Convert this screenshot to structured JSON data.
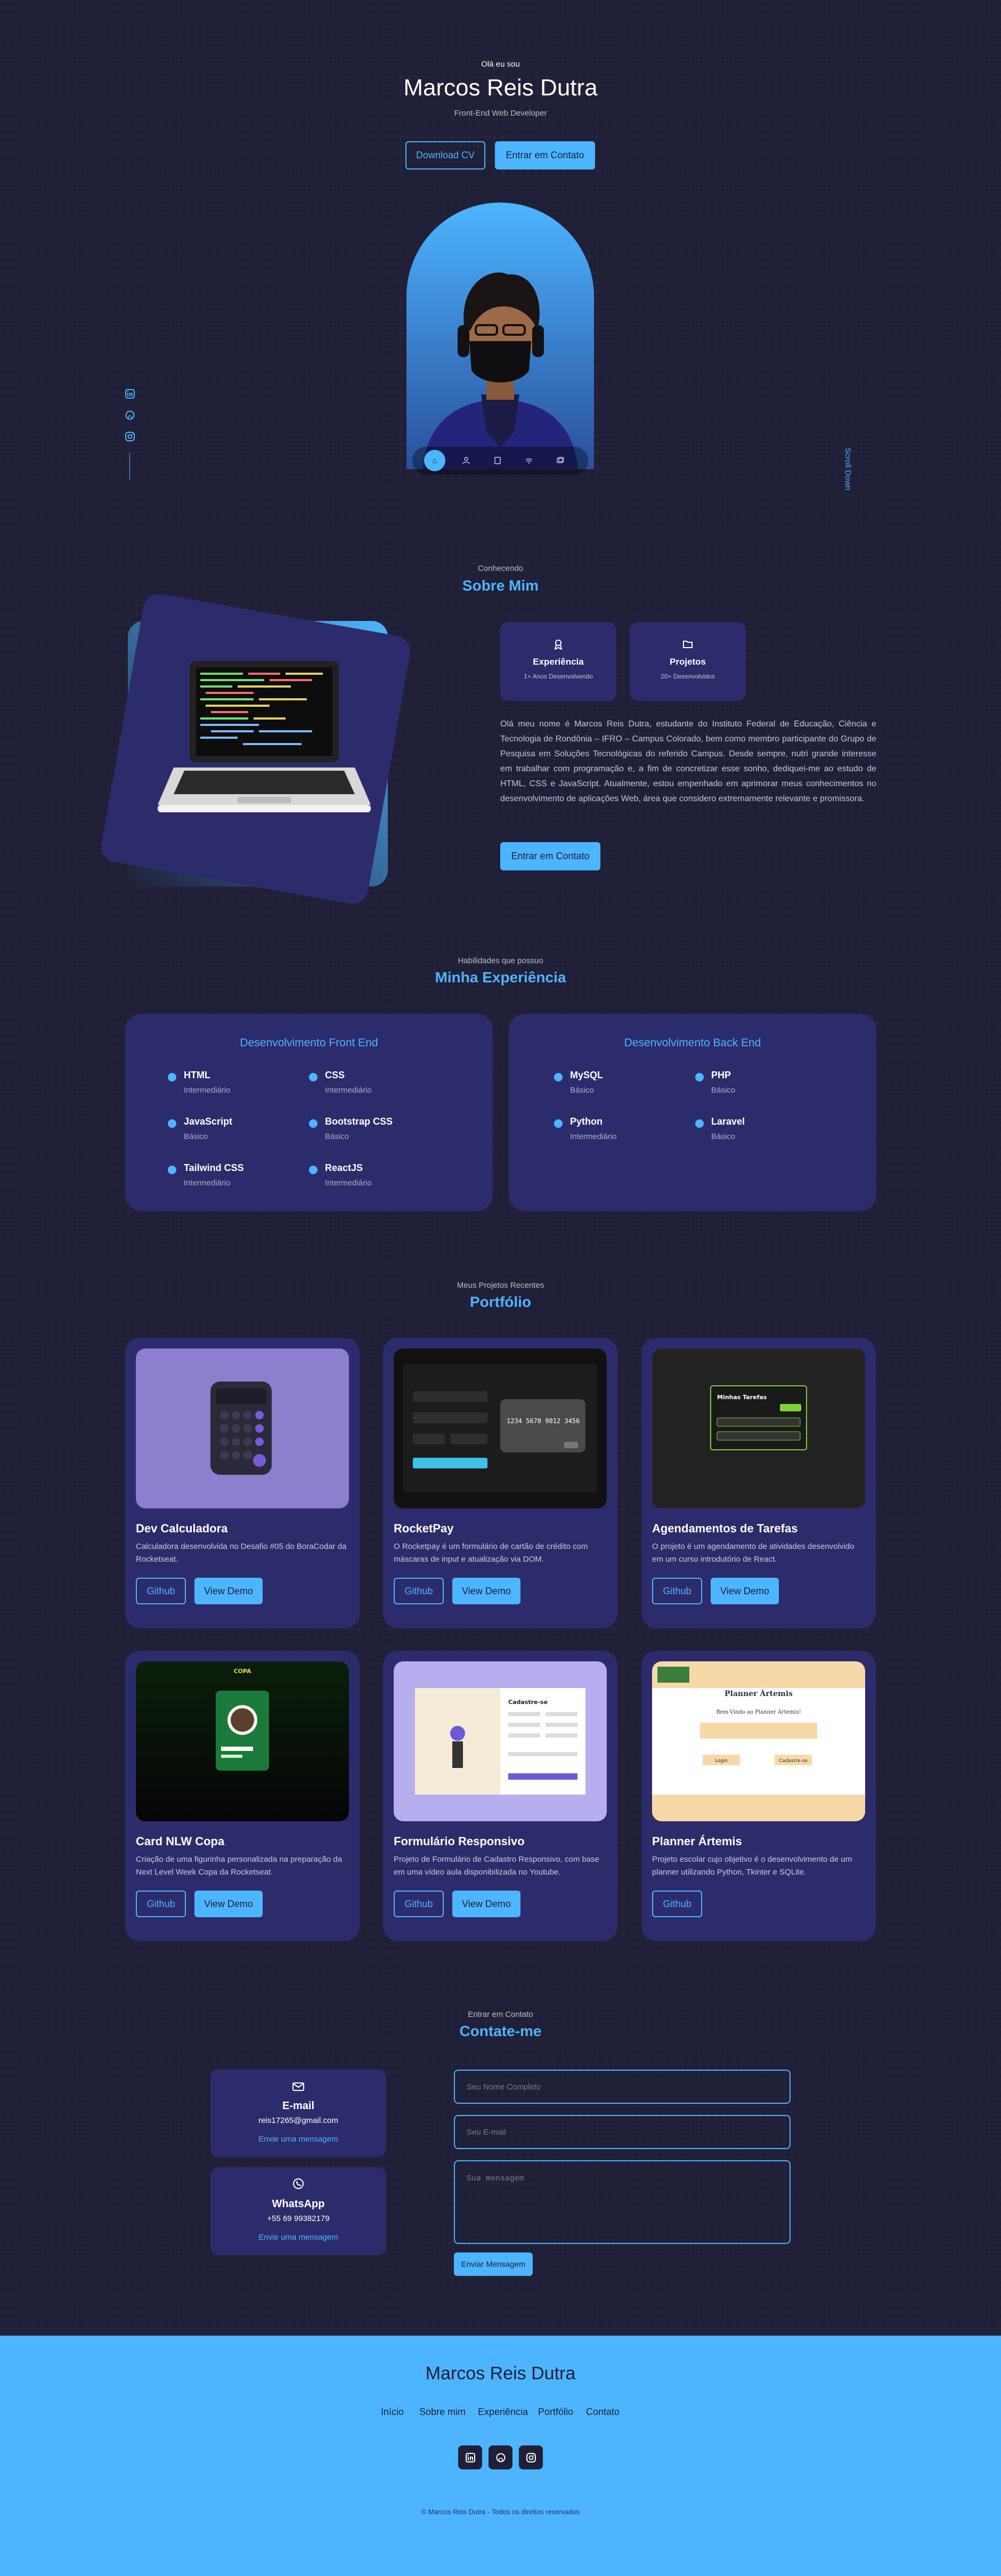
{
  "header": {
    "greeting": "Olá eu sou",
    "name": "Marcos Reis Dutra",
    "role": "Front-End Web Developer",
    "download_cv": "Download CV",
    "contact_btn": "Entrar em Contato",
    "scroll_down": "Scroll Down"
  },
  "about": {
    "small": "Conhecendo",
    "title": "Sobre Mim",
    "card1_title": "Experiência",
    "card1_sub": "1+ Anos Desenvolvendo",
    "card2_title": "Projetos",
    "card2_sub": "20+ Desenvolvidos",
    "paragraph": "Olá meu nome é Marcos Reis Dutra, estudante do Instituto Federal de Educação, Ciência e Tecnologia de Rondônia – IFRO – Campus Colorado, bem como membro participante do Grupo de Pesquisa em Soluções Tecnológicas do referido Campus. Desde sempre, nutri grande interesse em trabalhar com programação e, a fim de concretizar esse sonho, dediquei-me ao estudo de HTML, CSS e JavaScript. Atualmente, estou empenhado em aprimorar meus conhecimentos no desenvolvimento de aplicações Web, área que considero extremamente relevante e promissora.",
    "button": "Entrar em Contato"
  },
  "experience": {
    "small": "Habilidades que possuo",
    "title": "Minha Experiência",
    "frontend_title": "Desenvolvimento Front End",
    "frontend": [
      {
        "name": "HTML",
        "level": "Intermediário"
      },
      {
        "name": "CSS",
        "level": "Intermediário"
      },
      {
        "name": "JavaScript",
        "level": "Básico"
      },
      {
        "name": "Bootstrap CSS",
        "level": "Básico"
      },
      {
        "name": "Tailwind CSS",
        "level": "Intermediário"
      },
      {
        "name": "ReactJS",
        "level": "Intermediário"
      }
    ],
    "backend_title": "Desenvolvimento Back End",
    "backend": [
      {
        "name": "MySQL",
        "level": "Básico"
      },
      {
        "name": "PHP",
        "level": "Básico"
      },
      {
        "name": "Python",
        "level": "Intermediário"
      },
      {
        "name": "Laravel",
        "level": "Básico"
      }
    ]
  },
  "portfolio": {
    "small": "Meus Projetos Recentes",
    "title": "Portfólio",
    "github": "Github",
    "demo": "View Demo",
    "projects": [
      {
        "title": "Dev Calculadora",
        "desc": "Calculadora desenvolvida no Desafio #05 do BoraCodar da Rocketseat."
      },
      {
        "title": "RocketPay",
        "desc": "O Rocketpay é um formulário de cartão de crédito com máscaras de input e atualização via DOM."
      },
      {
        "title": "Agendamentos de Tarefas",
        "desc": "O projeto é um agendamento de atividades desenvolvido em um curso introdutório de React."
      },
      {
        "title": "Card NLW Copa",
        "desc": "Criação de uma figurinha personalizada na preparação da Next Level Week Copa da Rocketseat."
      },
      {
        "title": "Formulário Responsivo",
        "desc": "Projeto de Formulário de Cadastro Responsivo, com base em uma vídeo aula disponibilizada no Youtube."
      },
      {
        "title": "Planner Ártemis",
        "desc": "Projeto escolar cujo objetivo é o desenvolvimento de um planner utilizando Python, Tkinter e SQLite."
      }
    ],
    "mock": {
      "card_number": "1234 5678 9012 3456",
      "todo_title": "Minhas Tarefas",
      "copa": "COPA",
      "form_title": "Cadastre-se",
      "planner_title": "Planner Ártemis",
      "planner_welcome": "Bem-Vindo ao Planner Ártemis!",
      "planner_login": "Login",
      "planner_cad": "Cadastre-se"
    }
  },
  "contact": {
    "small": "Entrar em Contato",
    "title": "Contate-me",
    "email_title": "E-mail",
    "email_value": "reis17265@gmail.com",
    "email_link": "Envie uma mensagem",
    "whats_title": "WhatsApp",
    "whats_value": "+55 69 99382179",
    "whats_link": "Envie uma mensagem",
    "ph_name": "Seu Nome Completo",
    "ph_email": "Seu E-mail",
    "ph_message": "Sua mensagem",
    "send": "Enviar Mensagem"
  },
  "footer": {
    "name": "Marcos Reis Dutra",
    "links": [
      "Início",
      "Sobre mim",
      "Experiência",
      "Portfólio",
      "Contato"
    ],
    "copyright": "© Marcos Reis Dutra - Todos os direitos reservados"
  },
  "colors": {
    "background": "#1f1f38",
    "card": "#2c2c6c",
    "accent": "#4db5ff"
  }
}
